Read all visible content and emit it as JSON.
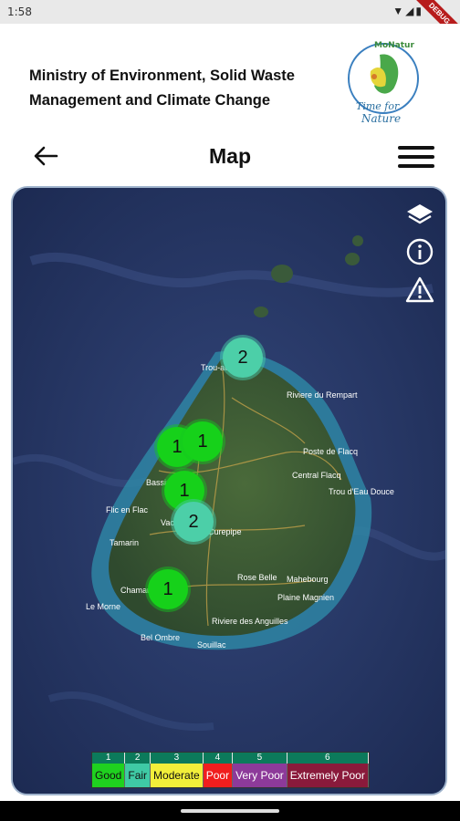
{
  "status_bar": {
    "time": "1:58",
    "icons": "▼◢▮",
    "debug_label": "DEBUG"
  },
  "header": {
    "ministry_title": "Ministry of Environment, Solid Waste Management and Climate Change",
    "logo": {
      "brand_top": "MoNatur",
      "tagline_line1": "Time for",
      "tagline_line2": "Nature"
    }
  },
  "toolbar": {
    "back_icon": "arrow-left-icon",
    "title": "Map",
    "menu_icon": "hamburger-menu-icon"
  },
  "map": {
    "controls": [
      "layers-icon",
      "info-icon",
      "warning-icon"
    ],
    "place_labels": [
      "Trou-aux-",
      "Riviere du Rempart",
      "Poste de Flacq",
      "Central Flacq",
      "Trou d'Eau Douce",
      "Bassin",
      "Flic en Flac",
      "Tamarin",
      "Rose Belle",
      "Mahebourg",
      "Plaine Magnien",
      "Chamarel",
      "Le Morne",
      "Riviere des Anguilles",
      "Bel Ombre",
      "Souillac",
      "Vacoas",
      "Curepipe"
    ],
    "clusters": [
      {
        "count": "2",
        "level": "Fair"
      },
      {
        "count": "1",
        "level": "Good"
      },
      {
        "count": "1",
        "level": "Good"
      },
      {
        "count": "1",
        "level": "Good"
      },
      {
        "count": "2",
        "level": "Fair"
      },
      {
        "count": "1",
        "level": "Good"
      }
    ]
  },
  "legend": {
    "items": [
      {
        "num": "1",
        "label": "Good",
        "color": "#1fd11f"
      },
      {
        "num": "2",
        "label": "Fair",
        "color": "#3fcaa5"
      },
      {
        "num": "3",
        "label": "Moderate",
        "color": "#f2ef3a"
      },
      {
        "num": "4",
        "label": "Poor",
        "color": "#f01e1e"
      },
      {
        "num": "5",
        "label": "Very Poor",
        "color": "#8d3a9a"
      },
      {
        "num": "6",
        "label": "Extremely Poor",
        "color": "#8a1a3b"
      }
    ]
  },
  "colors": {
    "good": "#16d11a",
    "fair": "#4ccfa8",
    "sea": "#22335a",
    "legend_header": "#0c7a5b"
  }
}
